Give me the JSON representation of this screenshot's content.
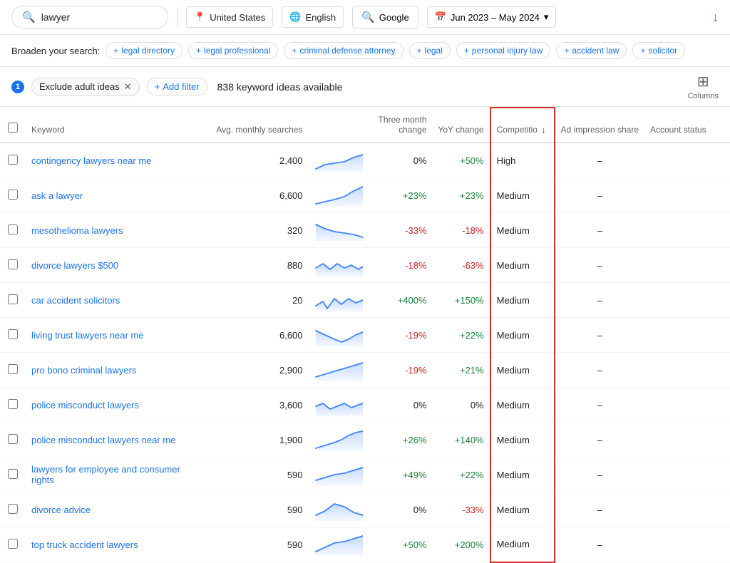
{
  "header": {
    "search_placeholder": "lawyer",
    "location": "United States",
    "language": "English",
    "platform": "Google",
    "date_range": "Jun 2023 – May 2024",
    "download_label": "↓"
  },
  "broaden": {
    "label": "Broaden your search:",
    "chips": [
      "legal directory",
      "legal professional",
      "criminal defense attorney",
      "legal",
      "personal injury law",
      "accident law",
      "solicitor"
    ]
  },
  "filters": {
    "badge": "1",
    "exclude_chip": "Exclude adult ideas",
    "add_filter": "Add filter",
    "keyword_count": "838 keyword ideas available",
    "columns_label": "Columns"
  },
  "table": {
    "columns": [
      {
        "key": "keyword",
        "label": "Keyword"
      },
      {
        "key": "monthly",
        "label": "Avg. monthly searches"
      },
      {
        "key": "sparkline",
        "label": ""
      },
      {
        "key": "three_month",
        "label": "Three month change"
      },
      {
        "key": "yoy",
        "label": "YoY change"
      },
      {
        "key": "competition",
        "label": "Competition",
        "sorted": true
      },
      {
        "key": "ad_share",
        "label": "Ad impression share"
      },
      {
        "key": "account_status",
        "label": "Account status"
      }
    ],
    "rows": [
      {
        "keyword": "contingency lawyers near me",
        "monthly": "2,400",
        "three_month": "0%",
        "yoy": "+50%",
        "competition": "High",
        "ad_share": "–",
        "account_status": "",
        "spark_trend": "up"
      },
      {
        "keyword": "ask a lawyer",
        "monthly": "6,600",
        "three_month": "+23%",
        "yoy": "+23%",
        "competition": "Medium",
        "ad_share": "–",
        "account_status": "",
        "spark_trend": "up_sharp"
      },
      {
        "keyword": "mesothelioma lawyers",
        "monthly": "320",
        "three_month": "-33%",
        "yoy": "-18%",
        "competition": "Medium",
        "ad_share": "–",
        "account_status": "",
        "spark_trend": "down"
      },
      {
        "keyword": "divorce lawyers $500",
        "monthly": "880",
        "three_month": "-18%",
        "yoy": "-63%",
        "competition": "Medium",
        "ad_share": "–",
        "account_status": "",
        "spark_trend": "wavy"
      },
      {
        "keyword": "car accident solicitors",
        "monthly": "20",
        "three_month": "+400%",
        "yoy": "+150%",
        "competition": "Medium",
        "ad_share": "–",
        "account_status": "",
        "spark_trend": "wavy2"
      },
      {
        "keyword": "living trust lawyers near me",
        "monthly": "6,600",
        "three_month": "-19%",
        "yoy": "+22%",
        "competition": "Medium",
        "ad_share": "–",
        "account_status": "",
        "spark_trend": "down_up"
      },
      {
        "keyword": "pro bono criminal lawyers",
        "monthly": "2,900",
        "three_month": "-19%",
        "yoy": "+21%",
        "competition": "Medium",
        "ad_share": "–",
        "account_status": "",
        "spark_trend": "up2"
      },
      {
        "keyword": "police misconduct lawyers",
        "monthly": "3,600",
        "three_month": "0%",
        "yoy": "0%",
        "competition": "Medium",
        "ad_share": "–",
        "account_status": "",
        "spark_trend": "wavy3"
      },
      {
        "keyword": "police misconduct lawyers near me",
        "monthly": "1,900",
        "three_month": "+26%",
        "yoy": "+140%",
        "competition": "Medium",
        "ad_share": "–",
        "account_status": "",
        "spark_trend": "up3"
      },
      {
        "keyword": "lawyers for employee and consumer rights",
        "monthly": "590",
        "three_month": "+49%",
        "yoy": "+22%",
        "competition": "Medium",
        "ad_share": "–",
        "account_status": "",
        "spark_trend": "up4"
      },
      {
        "keyword": "divorce advice",
        "monthly": "590",
        "three_month": "0%",
        "yoy": "-33%",
        "competition": "Medium",
        "ad_share": "–",
        "account_status": "",
        "spark_trend": "peak"
      },
      {
        "keyword": "top truck accident lawyers",
        "monthly": "590",
        "three_month": "+50%",
        "yoy": "+200%",
        "competition": "Medium",
        "ad_share": "–",
        "account_status": "",
        "spark_trend": "up5"
      }
    ]
  }
}
